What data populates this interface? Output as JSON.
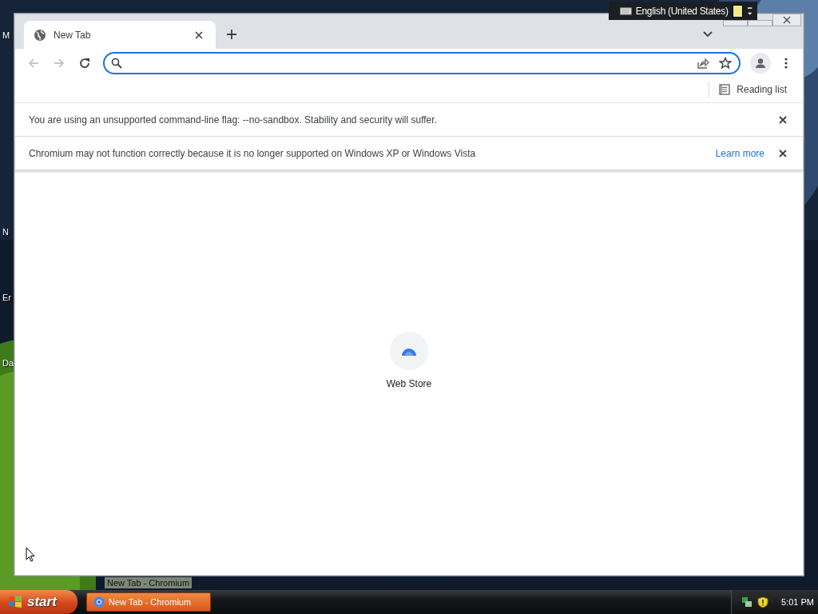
{
  "desktop": {
    "icon_labels": [
      "M",
      "N",
      "Er",
      "Da"
    ]
  },
  "language_bar": {
    "label": "English (United States)"
  },
  "browser": {
    "tabs": [
      {
        "title": "New Tab",
        "selected": true
      }
    ],
    "navigation": {
      "back_disabled": true,
      "forward_disabled": true
    },
    "reading_list": "Reading list",
    "infobars": [
      {
        "message": "You are using an unsupported command-line flag: --no-sandbox. Stability and security will suffer."
      },
      {
        "message": "Chromium may not function correctly because it is no longer supported on Windows XP or Windows Vista",
        "link": "Learn more"
      }
    ],
    "shortcuts": [
      {
        "label": "Web Store"
      }
    ]
  },
  "taskbar": {
    "start": "start",
    "tasks": [
      {
        "label": "New Tab - Chromium",
        "selected": true
      }
    ],
    "tooltip": "New Tab - Chromium",
    "clock": "5:01 PM"
  }
}
